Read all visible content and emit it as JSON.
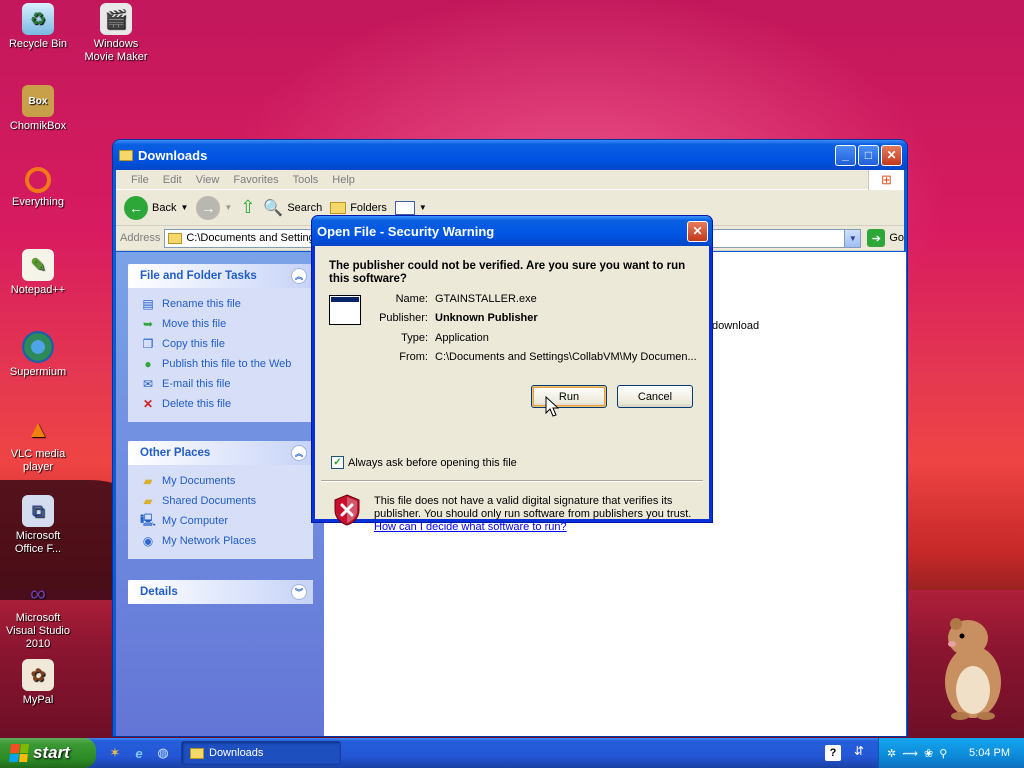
{
  "desktop": {
    "icons": [
      {
        "label": "Recycle Bin",
        "icon": "recycle-bin-icon"
      },
      {
        "label": "Windows Movie Maker",
        "icon": "movie-maker-icon"
      },
      {
        "label": "ChomikBox",
        "icon": "chomikbox-icon"
      },
      {
        "label": "Everything",
        "icon": "everything-icon"
      },
      {
        "label": "Notepad++",
        "icon": "notepad-plus-plus-icon"
      },
      {
        "label": "Supermium",
        "icon": "supermium-icon"
      },
      {
        "label": "VLC media player",
        "icon": "vlc-icon"
      },
      {
        "label": "Microsoft Office F...",
        "icon": "office-icon"
      },
      {
        "label": "Microsoft Visual Studio 2010",
        "icon": "visual-studio-icon"
      },
      {
        "label": "MyPal",
        "icon": "mypal-icon"
      }
    ]
  },
  "explorer": {
    "title": "Downloads",
    "menu": [
      "File",
      "Edit",
      "View",
      "Favorites",
      "Tools",
      "Help"
    ],
    "toolbar": {
      "back": "Back",
      "search": "Search",
      "folders": "Folders"
    },
    "address": {
      "label": "Address",
      "value": "C:\\Documents and Settings",
      "go": "Go"
    },
    "file_tasks": {
      "title": "File and Folder Tasks",
      "items": [
        "Rename this file",
        "Move this file",
        "Copy this file",
        "Publish this file to the Web",
        "E-mail this file",
        "Delete this file"
      ]
    },
    "other_places": {
      "title": "Other Places",
      "items": [
        "My Documents",
        "Shared Documents",
        "My Computer",
        "My Network Places"
      ]
    },
    "details": {
      "title": "Details"
    },
    "file_partial": "download"
  },
  "dialog": {
    "title": "Open File - Security Warning",
    "question": "The publisher could not be verified.  Are you sure you want to run this software?",
    "fields": {
      "name_label": "Name:",
      "name": "GTAINSTALLER.exe",
      "publisher_label": "Publisher:",
      "publisher": "Unknown Publisher",
      "type_label": "Type:",
      "type": "Application",
      "from_label": "From:",
      "from": "C:\\Documents and Settings\\CollabVM\\My Documen..."
    },
    "run": "Run",
    "cancel": "Cancel",
    "checkbox": {
      "label": "Always ask before opening this file",
      "checked": true
    },
    "warning": "This file does not have a valid digital signature that verifies its publisher.  You should only run software from publishers you trust.",
    "link": "How can I decide what software to run?"
  },
  "taskbar": {
    "start": "start",
    "task": "Downloads",
    "clock": "5:04 PM"
  }
}
